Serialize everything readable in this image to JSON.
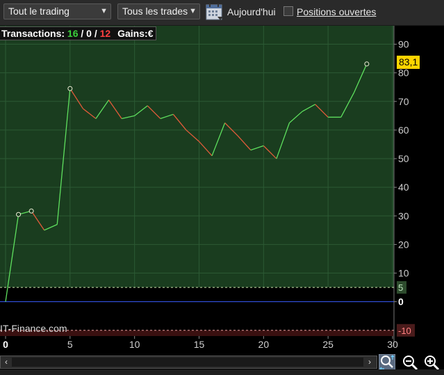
{
  "toolbar": {
    "scope_select": "Tout le trading",
    "trades_select": "Tous les trades",
    "calendar_icon": "calendar-icon",
    "today_label": "Aujourd'hui",
    "open_positions_label": "Positions ouvertes",
    "open_positions_checked": false
  },
  "summary": {
    "label": "Transactions:",
    "wins": "16",
    "sep1": "/",
    "neutral": "0",
    "sep2": "/",
    "losses": "12",
    "gains_label": "Gains:",
    "currency": "€"
  },
  "brand_text": "IT-Finance.com",
  "last_value_label": "83,1",
  "colors": {
    "panel_bg": "#1a3d1f",
    "up_line": "#5ee05e",
    "down_line": "#e25b3a",
    "zero_line": "#3a5cff",
    "badge": "#ffd400"
  },
  "chart_data": {
    "type": "line",
    "xlim": [
      0,
      30
    ],
    "ylim": [
      -12,
      95
    ],
    "x_ticks": [
      "0",
      "5",
      "10",
      "15",
      "20",
      "25",
      "30"
    ],
    "y_ticks": [
      "90",
      "80",
      "70",
      "60",
      "50",
      "40",
      "30",
      "20",
      "10",
      "0"
    ],
    "ref_lines": [
      {
        "label": "5",
        "value": 5
      },
      {
        "label": "-10",
        "value": -10
      }
    ],
    "x": [
      0,
      1,
      2,
      3,
      4,
      5,
      6,
      7,
      8,
      9,
      10,
      11,
      12,
      13,
      14,
      15,
      16,
      17,
      18,
      19,
      20,
      21,
      22,
      23,
      24,
      25,
      26,
      27,
      28
    ],
    "y": [
      0,
      30.5,
      31.7,
      25,
      27,
      74.5,
      67.5,
      64,
      70.5,
      64,
      65,
      68.5,
      64,
      65.5,
      60,
      56,
      51,
      62.5,
      58,
      53,
      54.5,
      50,
      62.5,
      66.5,
      69,
      64.5,
      64.5,
      73,
      83.1
    ],
    "markers": [
      1,
      2,
      5,
      28
    ]
  },
  "scrollbar": {
    "left_arrow": "‹",
    "right_arrow": "›"
  }
}
